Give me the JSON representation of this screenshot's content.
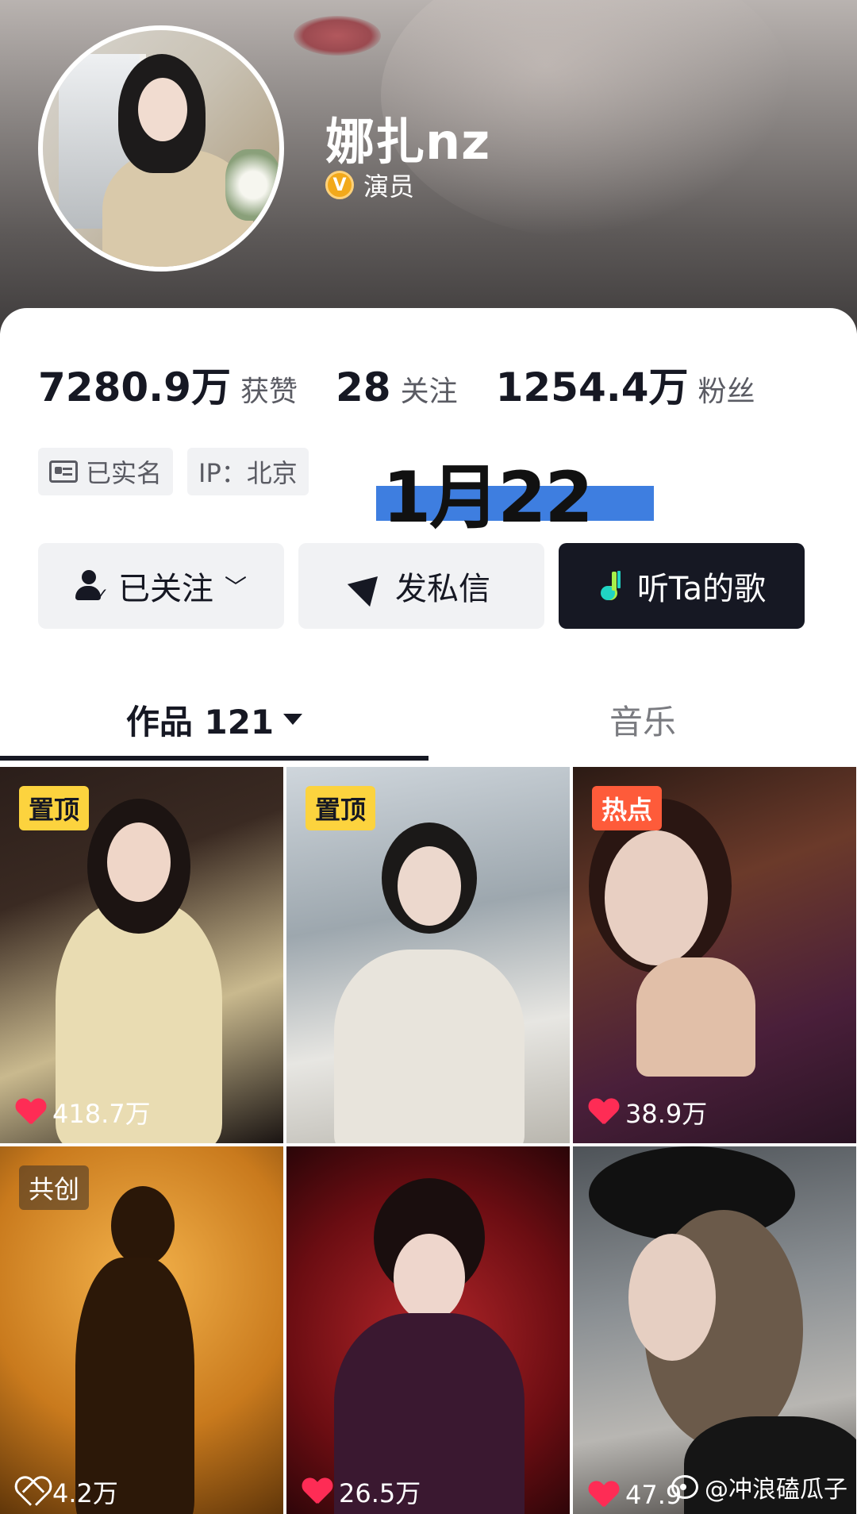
{
  "profile": {
    "username": "娜扎nz",
    "verification": "演员",
    "verify_badge_letter": "V"
  },
  "stats": [
    {
      "value": "7280.9万",
      "label": "获赞"
    },
    {
      "value": "28",
      "label": "关注"
    },
    {
      "value": "1254.4万",
      "label": "粉丝"
    }
  ],
  "tags": {
    "realname": "已实名",
    "ip": "IP：北京"
  },
  "date_overlay": "1月22日",
  "actions": {
    "follow": "已关注",
    "message": "发私信",
    "music": "听Ta的歌"
  },
  "tabs": {
    "works": "作品 121",
    "music": "音乐"
  },
  "tiles": [
    {
      "badge": "置顶",
      "likes": "418.7万"
    },
    {
      "badge": "置顶",
      "likes": ""
    },
    {
      "badge": "热点",
      "likes": "38.9万"
    },
    {
      "badge": "共创",
      "likes": "4.2万"
    },
    {
      "badge": "",
      "likes": "26.5万"
    },
    {
      "badge": "",
      "likes": "47.9"
    }
  ],
  "watermark": "@冲浪磕瓜子",
  "colors": {
    "accent_red": "#fe2c55",
    "pin_yellow": "#fcd33e",
    "hot_orange": "#fe5b3a",
    "date_bar_blue": "#3e7ee0",
    "dark": "#161823"
  }
}
